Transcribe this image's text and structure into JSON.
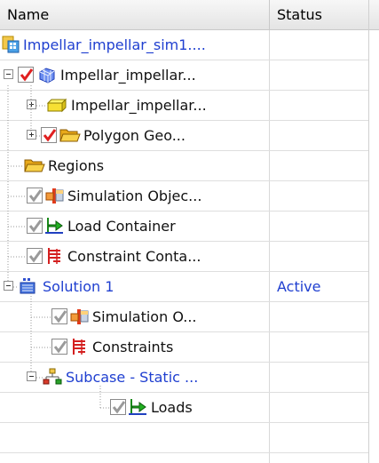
{
  "columns": {
    "name": "Name",
    "status": "Status"
  },
  "tree": [
    {
      "label": "Impellar_impellar_sim1....",
      "icon": "sim-file-icon",
      "blue": true,
      "status": ""
    },
    {
      "label": "Impellar_impellar...",
      "icon": "fem-mesh-icon",
      "checkbox": "checked-red",
      "toggle": "minus",
      "status": ""
    },
    {
      "label": "Impellar_impellar...",
      "icon": "part-body-icon",
      "toggle": "plus",
      "status": ""
    },
    {
      "label": "Polygon Geo...",
      "icon": "folder-icon",
      "checkbox": "checked-red",
      "toggle": "plus",
      "status": ""
    },
    {
      "label": "Regions",
      "icon": "folder-icon",
      "status": ""
    },
    {
      "label": "Simulation Objec...",
      "icon": "simulation-object-icon",
      "checkbox": "checked-gray",
      "status": ""
    },
    {
      "label": "Load Container",
      "icon": "load-icon",
      "checkbox": "checked-gray",
      "status": ""
    },
    {
      "label": "Constraint Conta...",
      "icon": "constraint-icon",
      "checkbox": "checked-gray",
      "status": ""
    },
    {
      "label": "Solution 1",
      "icon": "solution-icon",
      "blue": true,
      "toggle": "minus",
      "status": "Active"
    },
    {
      "label": "Simulation O...",
      "icon": "simulation-object-icon",
      "checkbox": "checked-gray",
      "status": ""
    },
    {
      "label": "Constraints",
      "icon": "constraint-icon",
      "checkbox": "checked-gray",
      "status": ""
    },
    {
      "label": "Subcase - Static ...",
      "icon": "subcase-icon",
      "blue": true,
      "toggle": "minus",
      "status": ""
    },
    {
      "label": "Loads",
      "icon": "load-icon",
      "checkbox": "checked-gray",
      "status": ""
    }
  ],
  "colors": {
    "link_blue": "#1f3fd0",
    "check_red": "#e02020",
    "check_gray": "#9a9a9a",
    "folder_yellow": "#f6c630"
  }
}
